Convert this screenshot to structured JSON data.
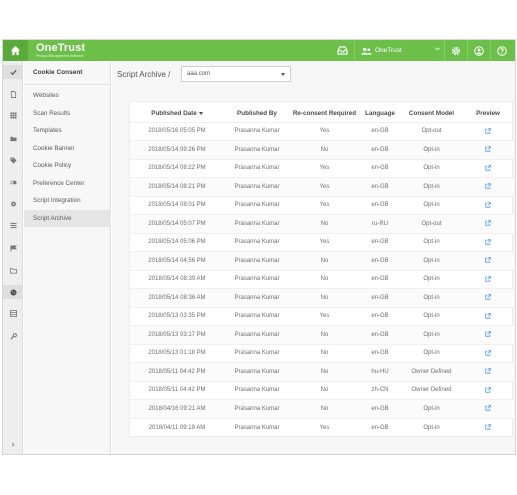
{
  "brand": {
    "name": "OneTrust",
    "tagline": "Privacy Management Software"
  },
  "colors": {
    "topbar": "#6cc04a",
    "accent": "#3a8ee6"
  },
  "topbar": {
    "org_name": "OneTrust",
    "icons": [
      "home-icon",
      "inbox-icon",
      "users-icon",
      "gear-icon",
      "user-circle-icon",
      "help-icon"
    ]
  },
  "rail": {
    "icons": [
      "check-icon",
      "document-icon",
      "grid-icon",
      "folder-icon",
      "tag-icon",
      "toggle-icon",
      "pin-icon",
      "list-icon",
      "flag-icon",
      "folder-outline-icon",
      "cookie-icon",
      "table-icon",
      "wrench-icon"
    ],
    "collapse_label": "›"
  },
  "subnav": {
    "title": "Cookie Consent",
    "items": [
      "Websites",
      "Scan Results",
      "Templates",
      "Cookie Banner",
      "Cookie Policy",
      "Preference Center",
      "Script Integration",
      "Script Archive"
    ],
    "active": "Script Archive"
  },
  "breadcrumb": "Script Archive /",
  "domain_select": {
    "value": "aaa.com"
  },
  "table": {
    "headers": {
      "published_date": "Published Date",
      "published_by": "Published By",
      "reconsent": "Re-consent Required",
      "language": "Language",
      "consent_model": "Consent Model",
      "preview": "Preview"
    },
    "rows": [
      {
        "date": "2018/05/16 05:05 PM",
        "by": "Prasanna Kumar",
        "reconsent": "Yes",
        "language": "en-GB",
        "model": "Opt-out"
      },
      {
        "date": "2018/05/14 09:26 PM",
        "by": "Prasanna Kumar",
        "reconsent": "No",
        "language": "en-GB",
        "model": "Opt-in"
      },
      {
        "date": "2018/05/14 08:22 PM",
        "by": "Prasanna Kumar",
        "reconsent": "Yes",
        "language": "en-GB",
        "model": "Opt-in"
      },
      {
        "date": "2018/05/14 08:21 PM",
        "by": "Prasanna Kumar",
        "reconsent": "Yes",
        "language": "en-GB",
        "model": "Opt-in"
      },
      {
        "date": "2018/05/14 08:01 PM",
        "by": "Prasanna Kumar",
        "reconsent": "Yes",
        "language": "en-GB",
        "model": "Opt-in"
      },
      {
        "date": "2018/05/14 05:07 PM",
        "by": "Prasanna Kumar",
        "reconsent": "No",
        "language": "ru-RU",
        "model": "Opt-out"
      },
      {
        "date": "2018/05/14 05:06 PM",
        "by": "Prasanna Kumar",
        "reconsent": "Yes",
        "language": "en-GB",
        "model": "Opt-in"
      },
      {
        "date": "2018/05/14 04:56 PM",
        "by": "Prasanna Kumar",
        "reconsent": "No",
        "language": "en-GB",
        "model": "Opt-in"
      },
      {
        "date": "2018/05/14 08:39 AM",
        "by": "Prasanna Kumar",
        "reconsent": "No",
        "language": "en-GB",
        "model": "Opt-in"
      },
      {
        "date": "2018/05/14 08:36 AM",
        "by": "Prasanna Kumar",
        "reconsent": "No",
        "language": "en-GB",
        "model": "Opt-in"
      },
      {
        "date": "2018/05/13 03:35 PM",
        "by": "Prasanna Kumar",
        "reconsent": "Yes",
        "language": "en-GB",
        "model": "Opt-in"
      },
      {
        "date": "2018/05/13 03:17 PM",
        "by": "Prasanna Kumar",
        "reconsent": "No",
        "language": "en-GB",
        "model": "Opt-in"
      },
      {
        "date": "2018/05/13 01:18 PM",
        "by": "Prasanna Kumar",
        "reconsent": "No",
        "language": "en-GB",
        "model": "Opt-in"
      },
      {
        "date": "2018/05/11 04:42 PM",
        "by": "Prasanna Kumar",
        "reconsent": "No",
        "language": "hu-HU",
        "model": "Owner Defined"
      },
      {
        "date": "2018/05/11 04:42 PM",
        "by": "Prasanna Kumar",
        "reconsent": "No",
        "language": "zh-CN",
        "model": "Owner Defined"
      },
      {
        "date": "2018/04/16 09:21 AM",
        "by": "Prasanna Kumar",
        "reconsent": "No",
        "language": "en-GB",
        "model": "Opt-in"
      },
      {
        "date": "2018/04/11 09:19 AM",
        "by": "Prasanna Kumar",
        "reconsent": "Yes",
        "language": "en-GB",
        "model": "Opt-in"
      }
    ]
  }
}
